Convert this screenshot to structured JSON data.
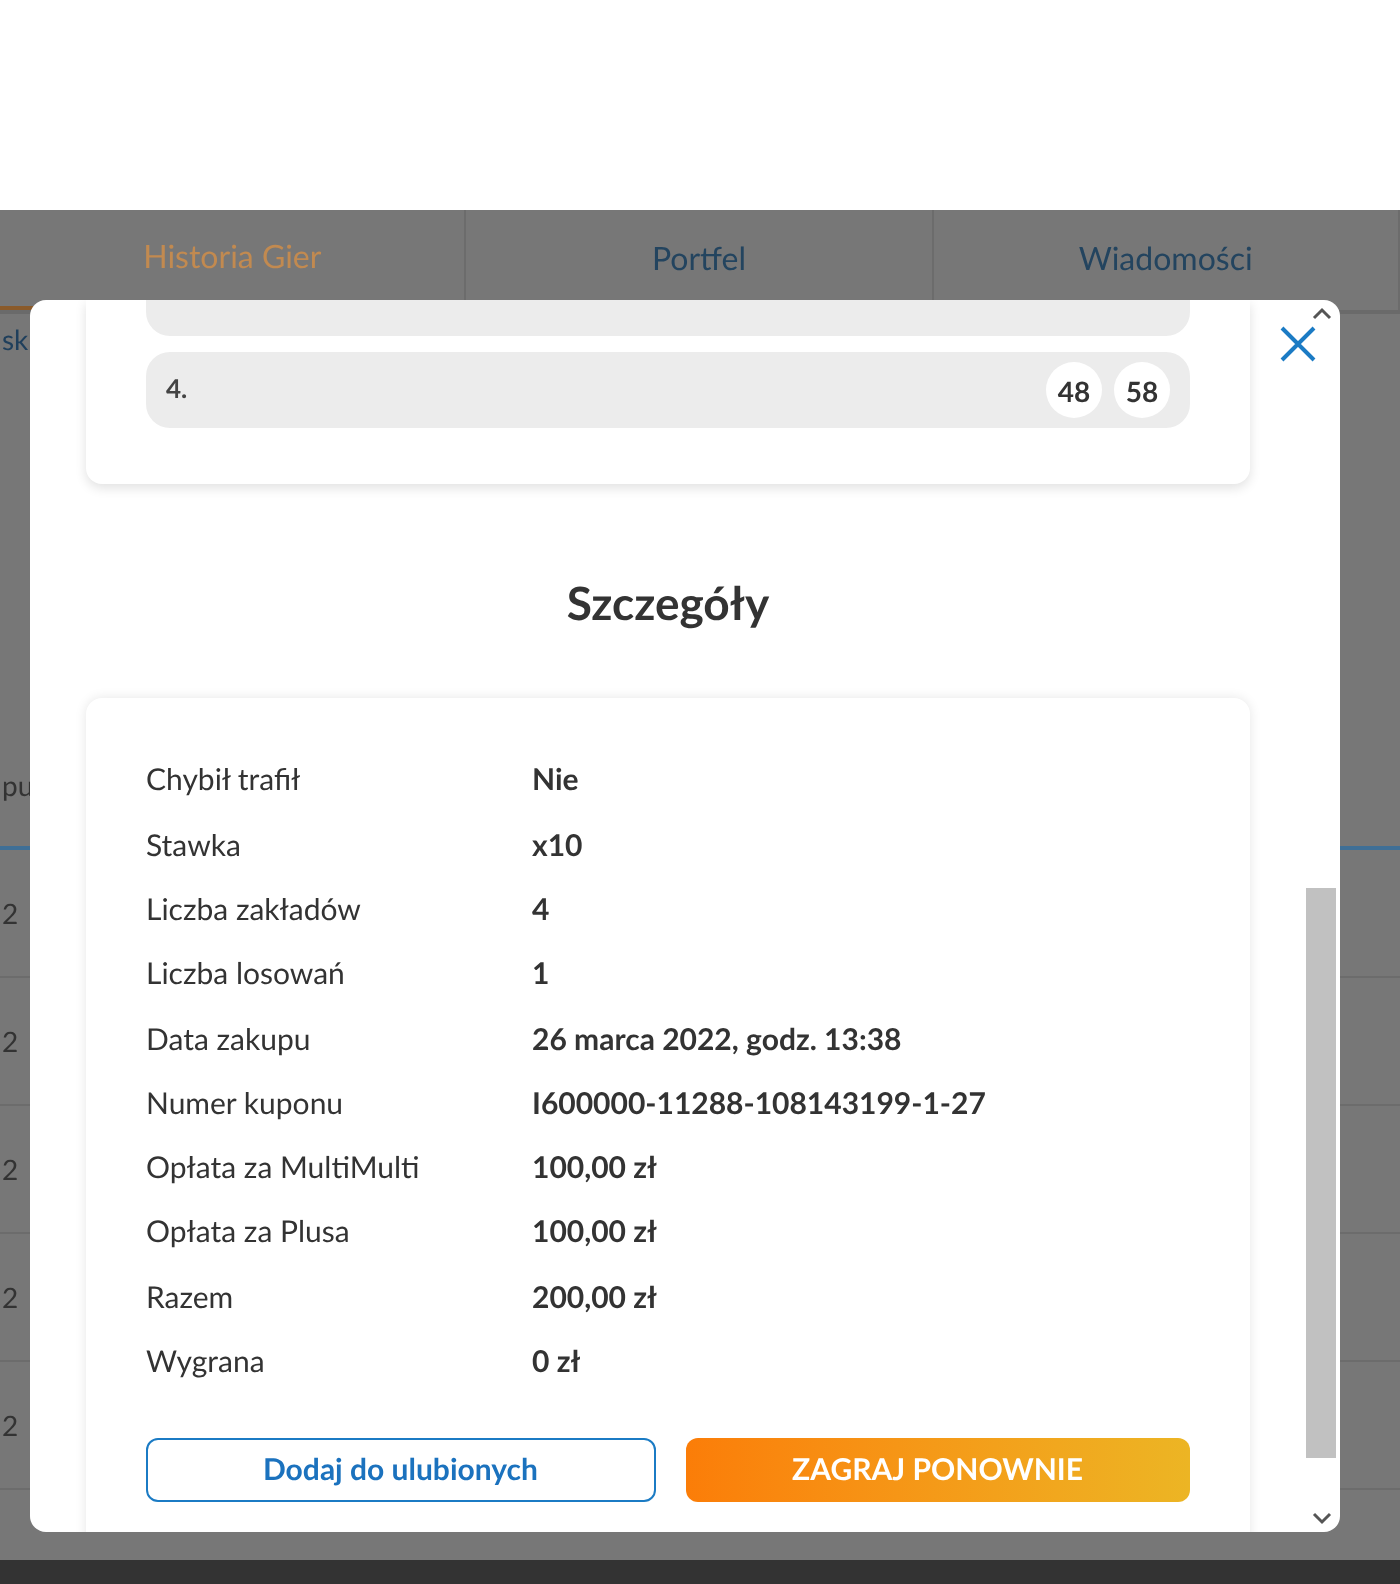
{
  "tabs": [
    {
      "label": "Historia Gier",
      "selected": true
    },
    {
      "label": "Portfel",
      "selected": false
    },
    {
      "label": "Wiadomości",
      "selected": false
    }
  ],
  "background_fragments": [
    {
      "text": "sk",
      "kind": "link"
    },
    {
      "text": "pu",
      "kind": "header"
    },
    {
      "text": "2",
      "kind": "cell"
    },
    {
      "text": "2",
      "kind": "cell"
    },
    {
      "text": "2",
      "kind": "cell"
    },
    {
      "text": "2",
      "kind": "cell"
    },
    {
      "text": "2",
      "kind": "cell"
    }
  ],
  "bets": [
    {
      "number": "4.",
      "balls": [
        "48",
        "58"
      ]
    }
  ],
  "details": {
    "title": "Szczegóły",
    "rows": [
      {
        "label": "Chybił trafił",
        "value": "Nie"
      },
      {
        "label": "Stawka",
        "value": "x10"
      },
      {
        "label": "Liczba zakładów",
        "value": "4"
      },
      {
        "label": "Liczba losowań",
        "value": "1"
      },
      {
        "label": "Data zakupu",
        "value": "26 marca 2022, godz. 13:38"
      },
      {
        "label": "Numer kuponu",
        "value": "I600000-11288-108143199-1-27"
      },
      {
        "label": "Opłata za MultiMulti",
        "value": "100,00 zł"
      },
      {
        "label": "Opłata za Plusa",
        "value": "100,00 zł"
      },
      {
        "label": "Razem",
        "value": "200,00 zł"
      },
      {
        "label": "Wygrana",
        "value": "0 zł"
      }
    ]
  },
  "buttons": [
    {
      "label": "Dodaj do ulubionych",
      "kind": "secondary"
    },
    {
      "label": "ZAGRAJ PONOWNIE",
      "kind": "primary"
    }
  ]
}
